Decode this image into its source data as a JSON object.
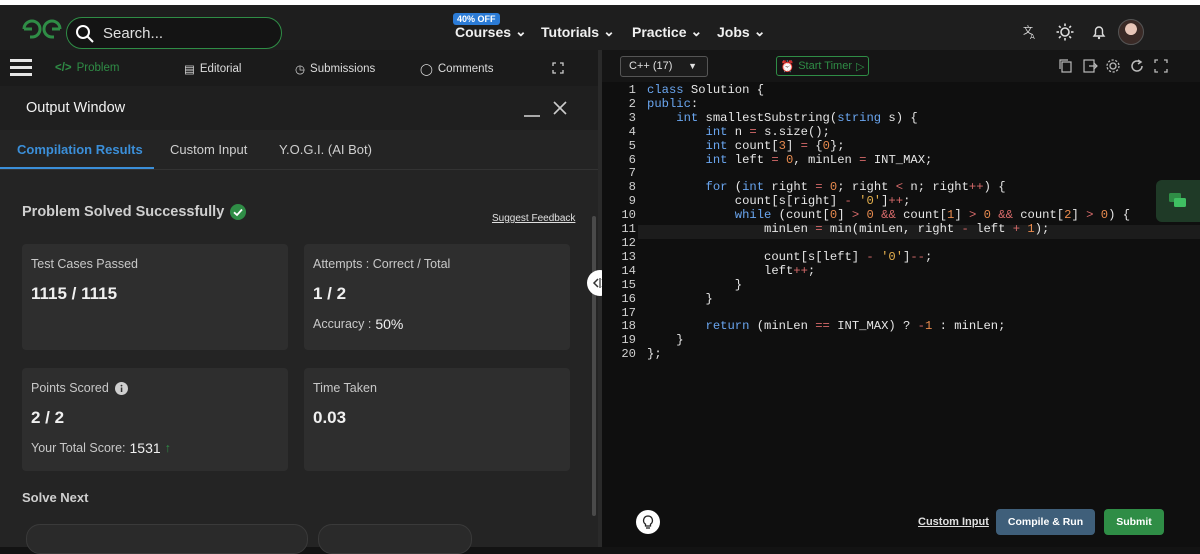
{
  "nav": {
    "search_placeholder": "Search...",
    "offer_badge": "40% OFF",
    "items": [
      "Courses",
      "Tutorials",
      "Practice",
      "Jobs"
    ]
  },
  "problem_tabs": [
    "Problem",
    "Editorial",
    "Submissions",
    "Comments"
  ],
  "output_window": {
    "title": "Output Window",
    "tabs": [
      "Compilation Results",
      "Custom Input",
      "Y.O.G.I. (AI Bot)"
    ],
    "result_title": "Problem Solved Successfully",
    "feedback_link": "Suggest Feedback",
    "cards": {
      "tests": {
        "label": "Test Cases Passed",
        "value": "1115 / 1115"
      },
      "attempts": {
        "label": "Attempts : Correct / Total",
        "value": "1 / 2",
        "sub_label": "Accuracy :",
        "sub_value": "50%"
      },
      "points": {
        "label": "Points Scored",
        "value": "2 / 2",
        "sub_label": "Your Total Score:",
        "sub_value": "1531"
      },
      "time": {
        "label": "Time Taken",
        "value": "0.03"
      }
    },
    "solve_next": "Solve Next"
  },
  "editor": {
    "language": "C++ (17)",
    "timer_label": "Start Timer",
    "line_numbers": [
      "1",
      "2",
      "3",
      "4",
      "5",
      "6",
      "7",
      "8",
      "9",
      "10",
      "11",
      "12",
      "13",
      "14",
      "15",
      "16",
      "17",
      "18",
      "19",
      "20"
    ],
    "custom_input": "Custom Input",
    "compile_run": "Compile & Run",
    "submit": "Submit"
  },
  "colors": {
    "brand_green": "#2f8d46",
    "tab_blue": "#3b8fd9",
    "submit_green": "#2f8d46",
    "compile_blue": "#3f5f7a"
  },
  "icons": [
    "search-icon",
    "translate-icon",
    "sun-icon",
    "bell-icon",
    "chat-icon",
    "lightbulb-icon"
  ]
}
